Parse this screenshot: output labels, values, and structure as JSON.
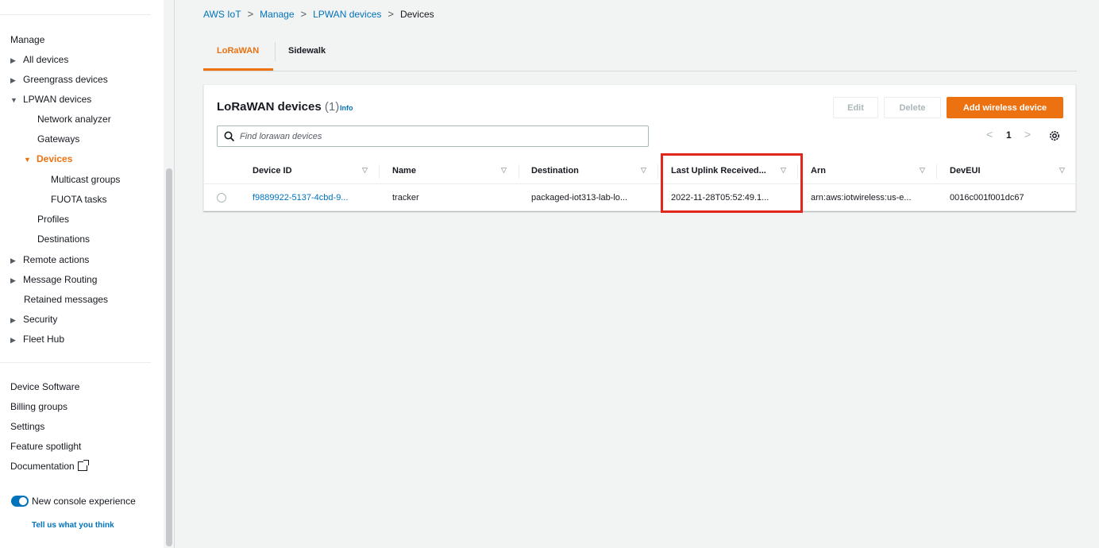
{
  "sidebar": {
    "manage_heading": "Manage",
    "items": [
      {
        "label": "All devices"
      },
      {
        "label": "Greengrass devices"
      },
      {
        "label": "LPWAN devices"
      },
      {
        "label": "Network analyzer"
      },
      {
        "label": "Gateways"
      },
      {
        "label": "Devices"
      },
      {
        "label": "Multicast groups"
      },
      {
        "label": "FUOTA tasks"
      },
      {
        "label": "Profiles"
      },
      {
        "label": "Destinations"
      },
      {
        "label": "Remote actions"
      },
      {
        "label": "Message Routing"
      },
      {
        "label": "Retained messages"
      },
      {
        "label": "Security"
      },
      {
        "label": "Fleet Hub"
      }
    ],
    "bottom_links": [
      {
        "label": "Device Software"
      },
      {
        "label": "Billing groups"
      },
      {
        "label": "Settings"
      },
      {
        "label": "Feature spotlight"
      },
      {
        "label": "Documentation"
      }
    ],
    "toggle_label": "New console experience",
    "feedback_link": "Tell us what you think"
  },
  "breadcrumb": [
    "AWS IoT",
    "Manage",
    "LPWAN devices",
    "Devices"
  ],
  "tabs": [
    {
      "label": "LoRaWAN",
      "active": true
    },
    {
      "label": "Sidewalk",
      "active": false
    }
  ],
  "panel": {
    "title": "LoRaWAN devices",
    "count": "(1)",
    "info": "Info",
    "edit_button": "Edit",
    "delete_button": "Delete",
    "add_button": "Add wireless device",
    "search_placeholder": "Find lorawan devices",
    "page_number": "1"
  },
  "table": {
    "columns": [
      "Device ID",
      "Name",
      "Destination",
      "Last Uplink Received...",
      "Arn",
      "DevEUI"
    ],
    "rows": [
      {
        "device_id": "f9889922-5137-4cbd-9...",
        "name": "tracker",
        "destination": "packaged-iot313-lab-lo...",
        "last_uplink": "2022-11-28T05:52:49.1...",
        "arn": "arn:aws:iotwireless:us-e...",
        "deveui": "0016c001f001dc67"
      }
    ]
  },
  "colors": {
    "accent": "#ec7211",
    "link": "#0073bb",
    "highlight_box": "#e1261c"
  },
  "icons": [
    "caret-right-icon",
    "caret-down-icon",
    "search-icon",
    "chevron-left-icon",
    "chevron-right-icon",
    "gear-icon",
    "external-link-icon",
    "sort-icon",
    "breadcrumb-chevron-icon"
  ]
}
